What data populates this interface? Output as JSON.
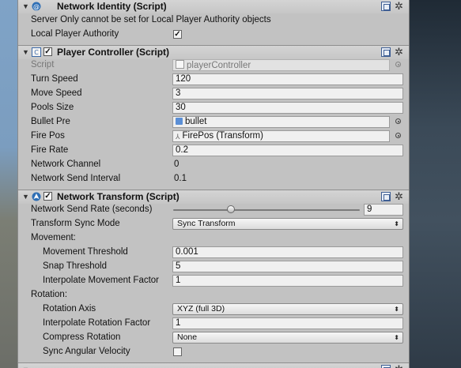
{
  "network_identity": {
    "title": "Network Identity (Script)",
    "notice": "Server Only cannot be set for Local Player Authority objects",
    "local_player_authority_label": "Local Player Authority",
    "local_player_authority": true
  },
  "player_controller": {
    "title": "Player Controller (Script)",
    "enabled": true,
    "script_label": "Script",
    "script_value": "playerController",
    "turn_speed_label": "Turn Speed",
    "turn_speed": "120",
    "move_speed_label": "Move Speed",
    "move_speed": "3",
    "pools_size_label": "Pools Size",
    "pools_size": "30",
    "bullet_pre_label": "Bullet Pre",
    "bullet_pre": "bullet",
    "fire_pos_label": "Fire Pos",
    "fire_pos": "FirePos (Transform)",
    "fire_rate_label": "Fire Rate",
    "fire_rate": "0.2",
    "network_channel_label": "Network Channel",
    "network_channel": "0",
    "network_send_interval_label": "Network Send Interval",
    "network_send_interval": "0.1"
  },
  "network_transform": {
    "title": "Network Transform (Script)",
    "enabled": true,
    "send_rate_label": "Network Send Rate (seconds)",
    "send_rate": "9",
    "send_rate_slider_fraction": 0.31,
    "sync_mode_label": "Transform Sync Mode",
    "sync_mode": "Sync Transform",
    "movement_label": "Movement:",
    "movement_threshold_label": "Movement Threshold",
    "movement_threshold": "0.001",
    "snap_threshold_label": "Snap Threshold",
    "snap_threshold": "5",
    "interp_movement_label": "Interpolate Movement Factor",
    "interp_movement": "1",
    "rotation_label": "Rotation:",
    "rotation_axis_label": "Rotation Axis",
    "rotation_axis": "XYZ (full 3D)",
    "interp_rotation_label": "Interpolate Rotation Factor",
    "interp_rotation": "1",
    "compress_rotation_label": "Compress Rotation",
    "compress_rotation": "None",
    "sync_angular_label": "Sync Angular Velocity",
    "sync_angular": false
  },
  "icons": {
    "fold": "triangle-down-icon",
    "help": "help-book-icon",
    "gear": "gear-icon"
  }
}
